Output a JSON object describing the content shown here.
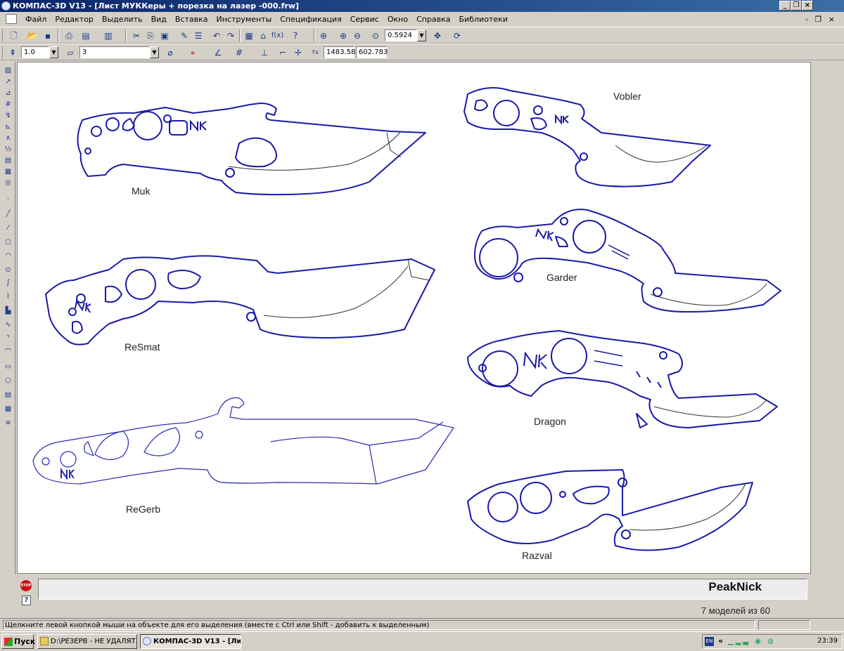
{
  "window": {
    "title": "КОМПАС-3D V13 - [Лист МУККеры + порезка на лазер -000.frw]",
    "controls": {
      "minimize": "_",
      "restore": "❐",
      "close": "×"
    },
    "mdi_controls": "- ❐ ×"
  },
  "menu": [
    "Файл",
    "Редактор",
    "Выделить",
    "Вид",
    "Вставка",
    "Инструменты",
    "Спецификация",
    "Сервис",
    "Окно",
    "Справка",
    "Библиотеки"
  ],
  "toolbar1": {
    "zoom_value": "0.5924"
  },
  "toolbar2": {
    "scale_value": "1.0",
    "layer_value": "3",
    "coord_x": "1483.58",
    "coord_y": "602.783"
  },
  "drawing": {
    "models": [
      {
        "name": "Muk"
      },
      {
        "name": "Vobler"
      },
      {
        "name": "Garder"
      },
      {
        "name": "ReSmat"
      },
      {
        "name": "Dragon"
      },
      {
        "name": "ReGerb"
      },
      {
        "name": "Razval"
      }
    ],
    "logo": "NK",
    "line_color": "#1a1aa8",
    "gray_line_color": "#2a2ab0"
  },
  "panel": {
    "brand": "PeakNick",
    "models_count": "7 моделей из 60"
  },
  "status": {
    "hint": "Щелкните левой кнопкой мыши на объекте для его выделения (вместе с Ctrl или Shift - добавить к выделенным)"
  },
  "taskbar": {
    "start": "Пуск",
    "items": [
      "D:\\РЕЗЕРВ - НЕ УДАЛЯТ...",
      "КОМПАС-3D V13 - [Ли..."
    ],
    "tray_lang": "EN",
    "clock": "23:39"
  }
}
